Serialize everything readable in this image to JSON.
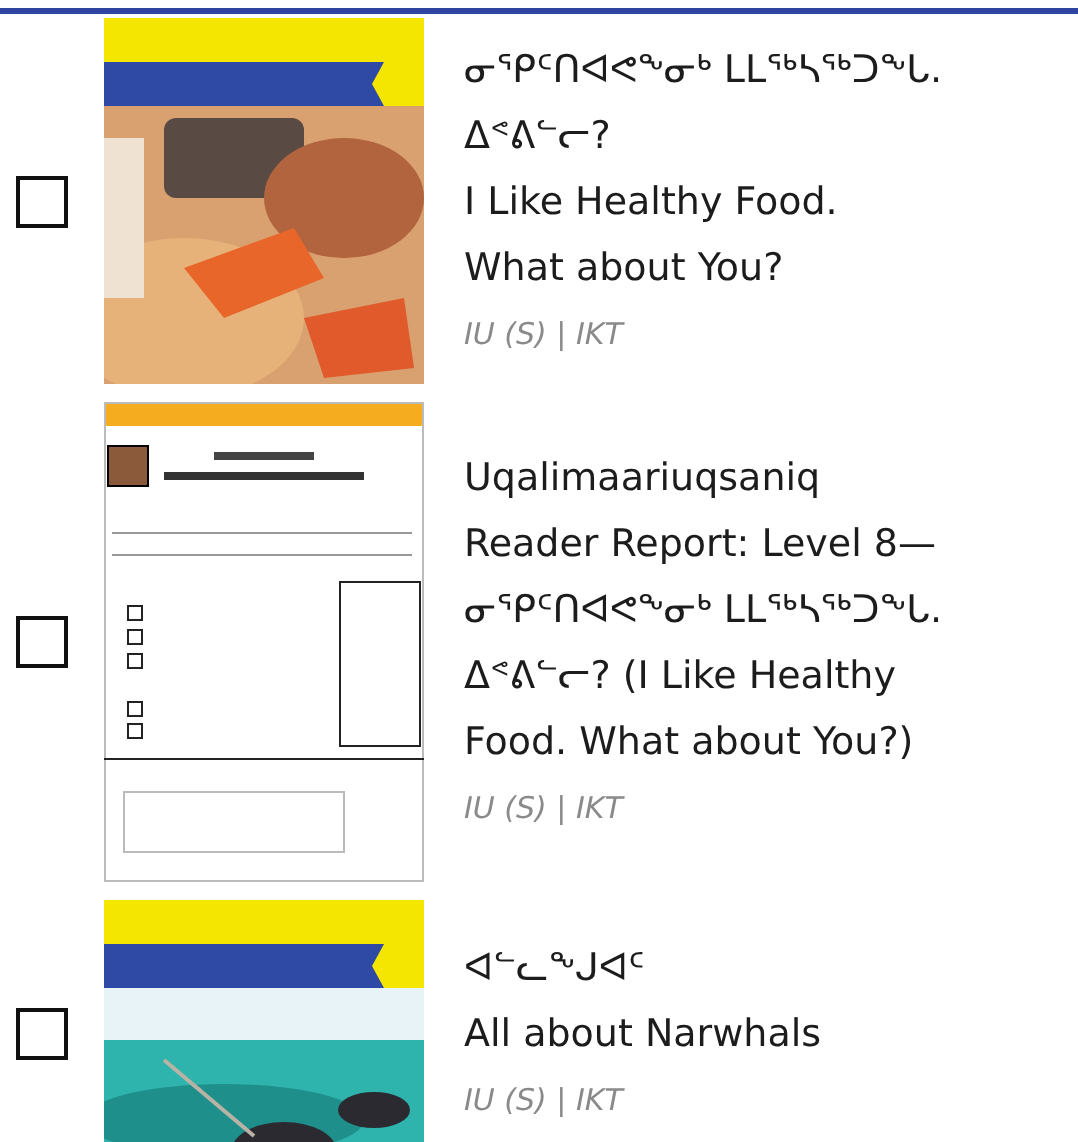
{
  "items": [
    {
      "checked": false,
      "thumbnail": {
        "kind": "cover"
      },
      "title_lines": [
        "ᓂᕿᑦᑎᐊᕙᖕᓂᒃ ᒪᒪᖅᓴᖅᑐᖕᒐ.",
        "ᐃᕝᕕᓪᓕ?",
        "I Like Healthy Food.",
        "What about You?"
      ],
      "meta": "IU (S) | IKT"
    },
    {
      "checked": false,
      "thumbnail": {
        "kind": "document"
      },
      "title_lines": [
        "Uqalimaariuqsaniq",
        "Reader Report: Level 8—",
        "ᓂᕿᑦᑎᐊᕙᖕᓂᒃ ᒪᒪᖅᓴᖅᑐᖕᒐ.",
        "ᐃᕝᕕᓪᓕ? (I Like Healthy",
        "Food. What about You?)"
      ],
      "meta": "IU (S) | IKT"
    },
    {
      "checked": false,
      "thumbnail": {
        "kind": "cover"
      },
      "title_lines": [
        "ᐊᓪᓚᖕᒍᐊᑦ",
        "All about Narwhals"
      ],
      "meta": "IU (S) | IKT"
    }
  ]
}
